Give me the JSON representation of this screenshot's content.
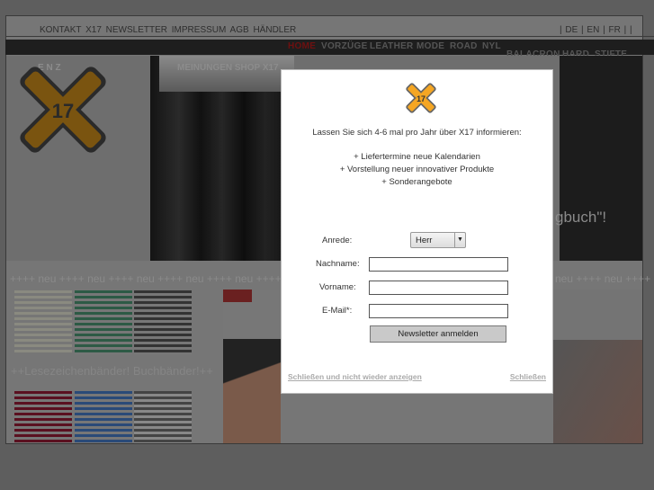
{
  "top_links": "KONTAKT  X17 NEWSLETTER  IMPRESSUM  AGB  HÄNDLER",
  "languages": "| DE  | EN  | FR  |    |",
  "nav": {
    "items": [
      "HOME",
      "VORZÜGE",
      "LEATHER",
      "MODE",
      "ROAD",
      "NYL",
      "BALACRON",
      "HARD",
      "STIFTE"
    ],
    "active_color": "#8b0000"
  },
  "submenu": "MEINUNGEN   SHOP   X17",
  "submenu_left": "E      N  Z",
  "hero_text": "gbuch\"!",
  "ticker": "++++ neu ++++ neu ++++ neu ++++ neu ++++ neu ++++ neu",
  "ticker_right": "neu ++++ neu ++++ n",
  "lesezeichen": "++Lesezeichenbänder! Buchbänder!++",
  "logo_text": "17",
  "modal": {
    "intro": "Lassen Sie sich 4-6 mal pro Jahr über X17 informieren:",
    "bullets": [
      "+  Liefertermine neue Kalendarien",
      "+  Vorstellung neuer innovativer Produkte",
      "+  Sonderangebote"
    ],
    "form": {
      "anrede_label": "Anrede:",
      "anrede_value": "Herr",
      "nachname_label": "Nachname:",
      "vorname_label": "Vorname:",
      "email_label": "E-Mail*:",
      "submit": "Newsletter anmelden"
    },
    "close_forever": "Schließen und nicht wieder anzeigen",
    "close": "Schließen"
  },
  "colors": {
    "logo": "#f5a623",
    "logo_dim": "#7a5410"
  }
}
